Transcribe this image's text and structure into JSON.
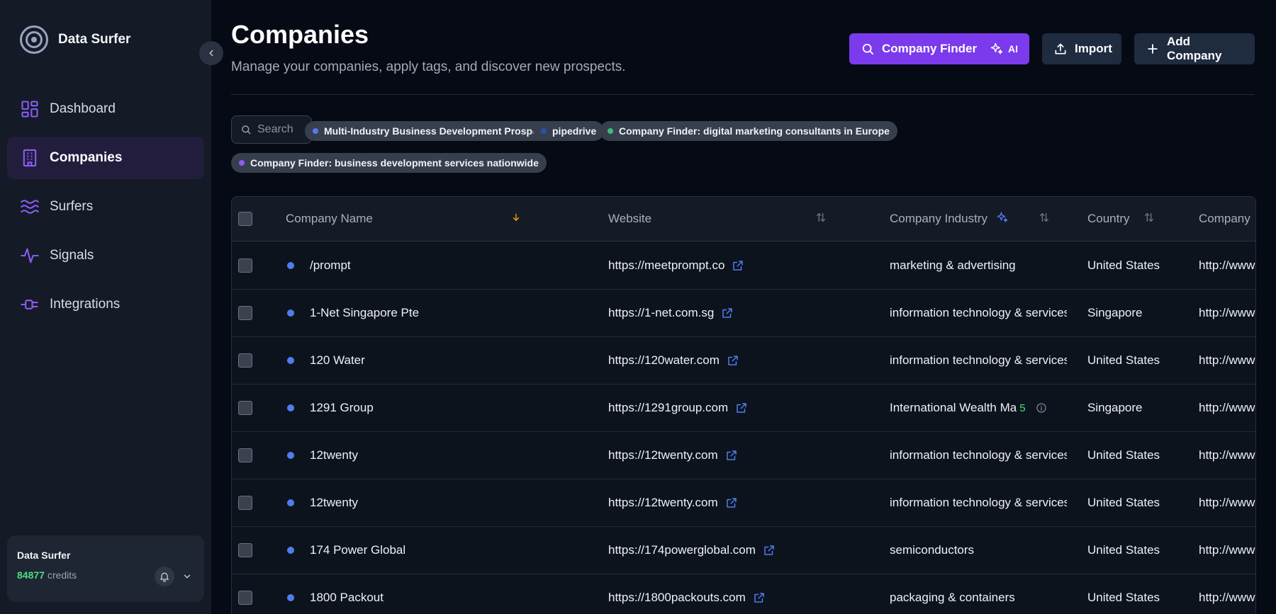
{
  "brand": {
    "name": "Data Surfer"
  },
  "nav": {
    "items": [
      {
        "label": "Dashboard"
      },
      {
        "label": "Companies"
      },
      {
        "label": "Surfers"
      },
      {
        "label": "Signals"
      },
      {
        "label": "Integrations"
      }
    ]
  },
  "account": {
    "name": "Data Surfer",
    "credits_value": "84877",
    "credits_label": "credits"
  },
  "header": {
    "title": "Companies",
    "subtitle": "Manage your companies, apply tags, and discover new prospects.",
    "finder_label": "Company Finder",
    "ai_label": "AI",
    "import_label": "Import",
    "add_label": "Add Company"
  },
  "search": {
    "placeholder": "Search"
  },
  "tags": [
    {
      "label": "Multi-Industry Business Development Prospects",
      "color": "#4f7cf0"
    },
    {
      "label": "pipedrive",
      "color": "#2b4fb0"
    },
    {
      "label": "Company Finder: digital marketing consultants in Europe",
      "color": "#3fb97a"
    },
    {
      "label": "Company Finder: business development services nationwide",
      "color": "#8b5cf6"
    }
  ],
  "table": {
    "columns": {
      "name": "Company Name",
      "website": "Website",
      "industry": "Company Industry",
      "country": "Country",
      "company": "Company"
    },
    "rows": [
      {
        "name": "/prompt",
        "website": "https://meetprompt.co",
        "industry": "marketing & advertising",
        "country": "United States",
        "company": "http://www"
      },
      {
        "name": "1-Net Singapore Pte",
        "website": "https://1-net.com.sg",
        "industry": "information technology & services",
        "country": "Singapore",
        "company": "http://www"
      },
      {
        "name": "120 Water",
        "website": "https://120water.com",
        "industry": "information technology & services",
        "country": "United States",
        "company": "http://www"
      },
      {
        "name": "1291 Group",
        "website": "https://1291group.com",
        "industry": "International Wealth Ma",
        "industry_badge": "5",
        "country": "Singapore",
        "company": "http://www"
      },
      {
        "name": "12twenty",
        "website": "https://12twenty.com",
        "industry": "information technology & services",
        "country": "United States",
        "company": "http://www"
      },
      {
        "name": "12twenty",
        "website": "https://12twenty.com",
        "industry": "information technology & services",
        "country": "United States",
        "company": "http://www"
      },
      {
        "name": "174 Power Global",
        "website": "https://174powerglobal.com",
        "industry": "semiconductors",
        "country": "United States",
        "company": "http://www"
      },
      {
        "name": "1800 Packout",
        "website": "https://1800packouts.com",
        "industry": "packaging & containers",
        "country": "United States",
        "company": "http://www"
      }
    ]
  },
  "colors": {
    "accent": "#7c3aed",
    "credits": "#4ade80",
    "row_dot": "#4f7cf0"
  }
}
